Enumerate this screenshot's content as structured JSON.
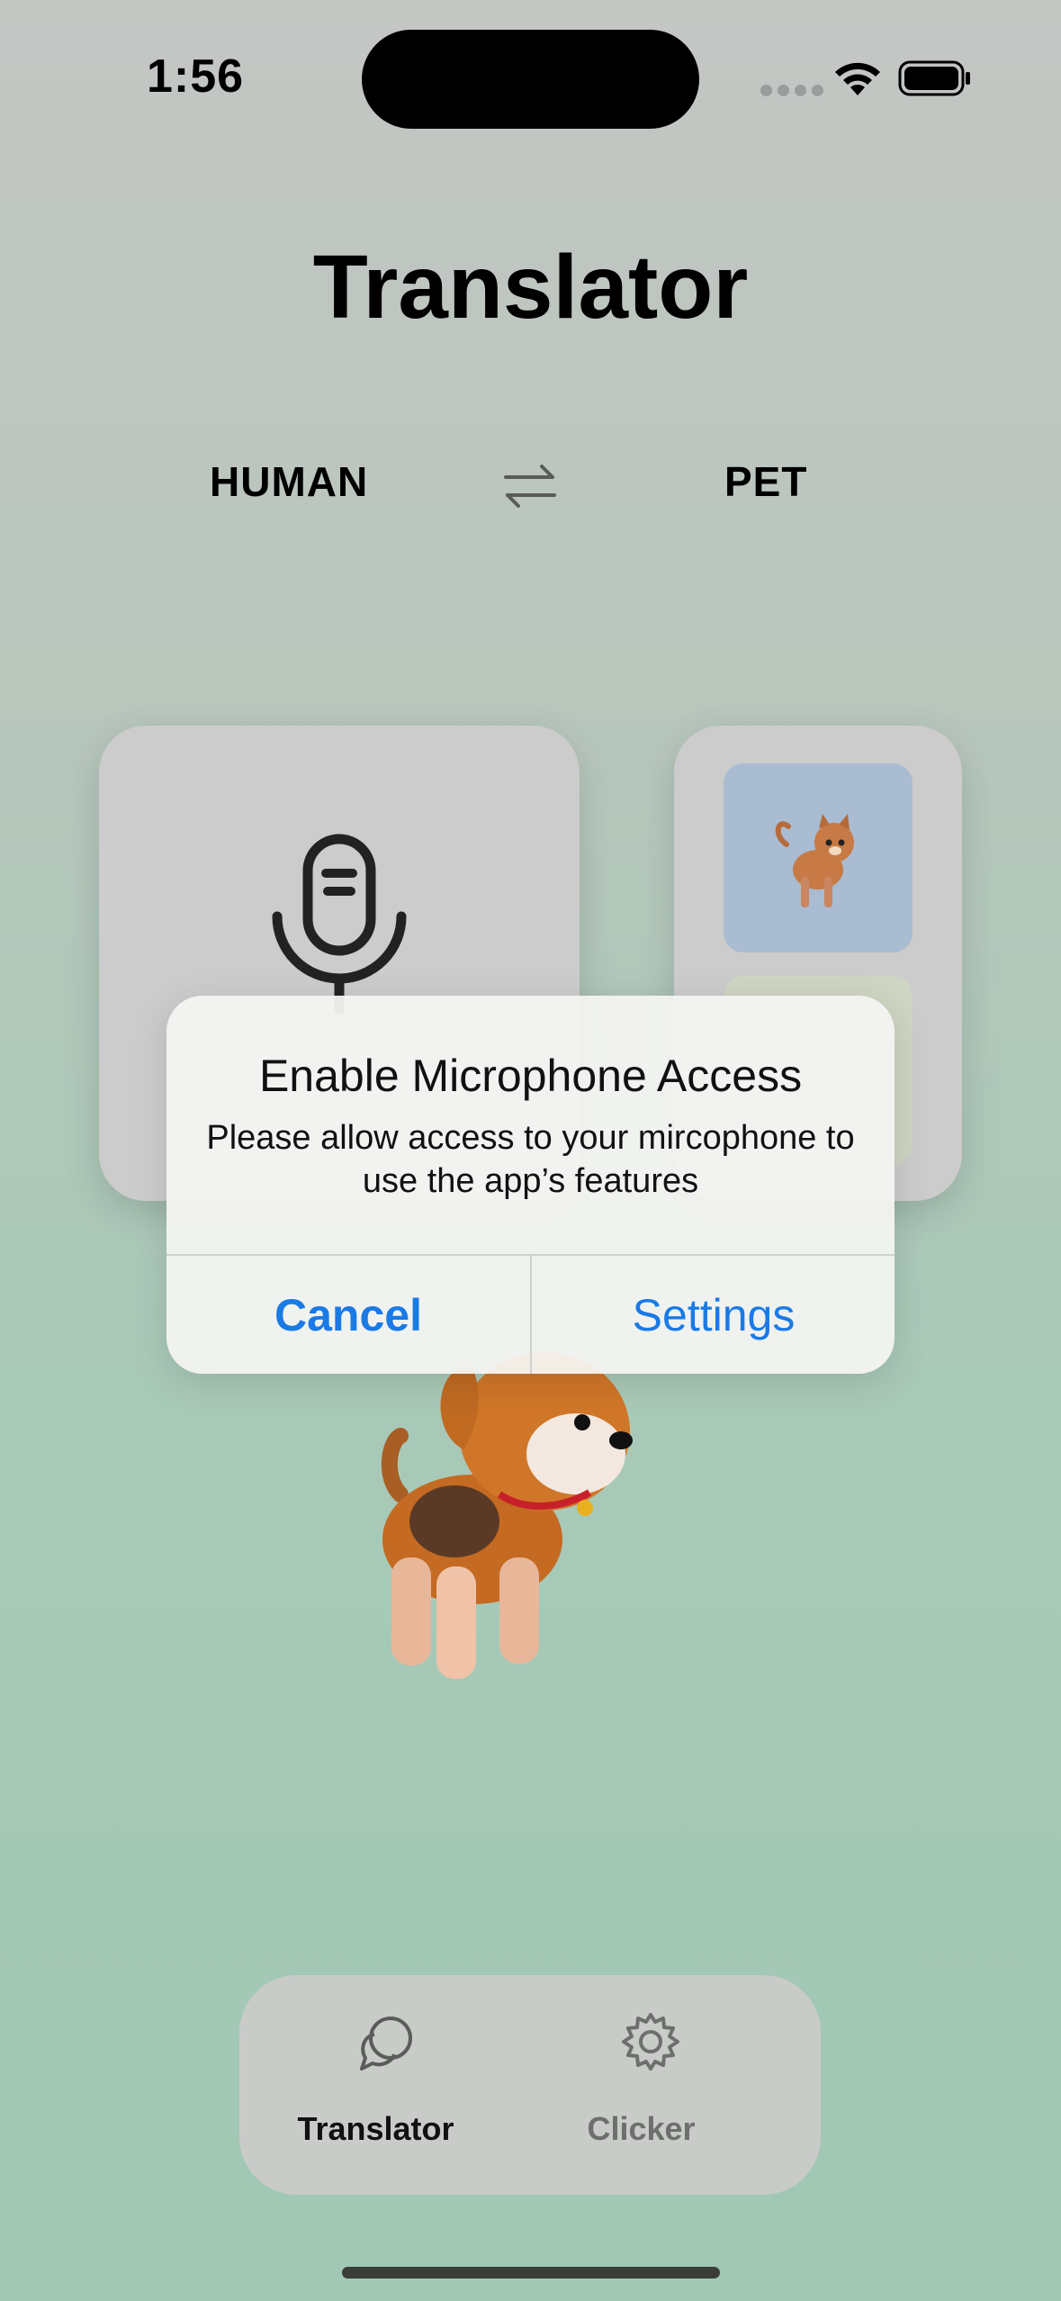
{
  "status_bar": {
    "time": "1:56"
  },
  "header": {
    "title": "Translator"
  },
  "language_switch": {
    "from": "HUMAN",
    "to": "PET",
    "swap_icon": "swap-arrows-icon"
  },
  "cards": {
    "mic_icon": "microphone-icon",
    "pets": [
      "cat",
      "dog"
    ]
  },
  "alert": {
    "title": "Enable Microphone Access",
    "message": "Please allow access to your mircophone to use the app’s features",
    "cancel_label": "Cancel",
    "settings_label": "Settings",
    "accent": "#1a7ae6"
  },
  "tabbar": {
    "tabs": [
      {
        "label": "Translator",
        "icon": "chat-bubbles-icon",
        "active": true
      },
      {
        "label": "Clicker",
        "icon": "gear-icon",
        "active": false
      }
    ]
  }
}
